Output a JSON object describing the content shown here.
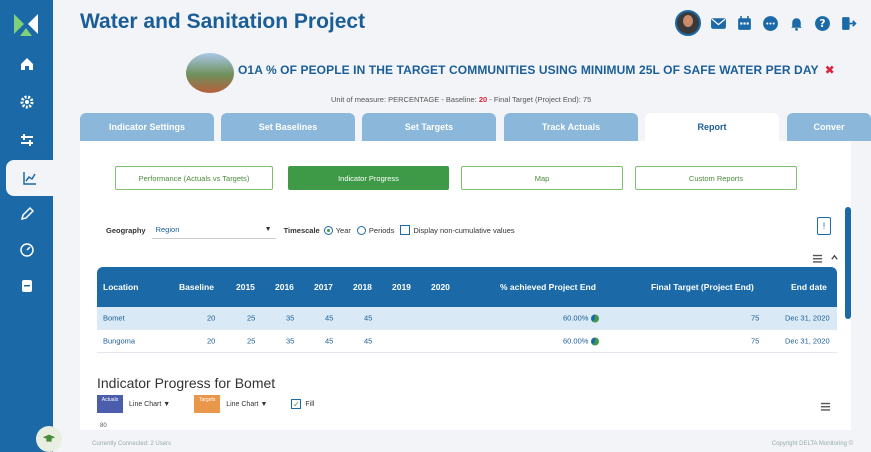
{
  "header": {
    "title": "Water and Sanitation Project"
  },
  "indicator": {
    "title": "O1A % OF PEOPLE IN THE TARGET COMMUNITIES USING MINIMUM 25L OF SAFE WATER PER DAY",
    "close_symbol": "✖",
    "unit_prefix": "Unit of measure: PERCENTAGE - Baseline: ",
    "baseline": "20",
    "final_target_text": " - Final Target (Project End): 75"
  },
  "tabs": [
    {
      "label": "Indicator Settings"
    },
    {
      "label": "Set Baselines"
    },
    {
      "label": "Set Targets"
    },
    {
      "label": "Track Actuals"
    },
    {
      "label": "Report"
    },
    {
      "label": "Conver"
    }
  ],
  "report_buttons": [
    {
      "label": "Performance (Actuals vs Targets)"
    },
    {
      "label": "Indicator Progress"
    },
    {
      "label": "Map"
    },
    {
      "label": "Custom Reports"
    }
  ],
  "filters": {
    "geography_label": "Geography",
    "geography_value": "Region",
    "timescale_label": "Timescale",
    "year_label": "Year",
    "periods_label": "Periods",
    "noncumulative_label": "Display non-cumulative values"
  },
  "info_button": "!",
  "table": {
    "columns": [
      "Location",
      "Baseline",
      "2015",
      "2016",
      "2017",
      "2018",
      "2019",
      "2020",
      "% achieved Project End",
      "Final Target (Project End)",
      "End date"
    ],
    "rows": [
      {
        "location": "Bomet",
        "baseline": "20",
        "y2015": "25",
        "y2016": "35",
        "y2017": "45",
        "y2018": "45",
        "y2019": "",
        "y2020": "",
        "achieved": "60.00%",
        "achieved_fraction": 0.6,
        "final_target": "75",
        "end_date": "Dec 31, 2020"
      },
      {
        "location": "Bungoma",
        "baseline": "20",
        "y2015": "25",
        "y2016": "35",
        "y2017": "45",
        "y2018": "45",
        "y2019": "",
        "y2020": "",
        "achieved": "60.00%",
        "achieved_fraction": 0.6,
        "final_target": "75",
        "end_date": "Dec 31, 2020"
      }
    ]
  },
  "chart_section": {
    "title": "Indicator Progress for Bomet",
    "actuals_label": "Actuals",
    "actuals_chart": "Line Chart",
    "targets_label": "Targets",
    "targets_chart": "Line Chart",
    "fill_label": "Fill",
    "y_first_tick": "80"
  },
  "footer": {
    "left": "Currently Connected: 2 Users",
    "right": "Copyright DELTA Monitoring ©"
  },
  "colors": {
    "primary": "#1b6aa7",
    "accent_green": "#3f9a48",
    "close_red": "#d7263d",
    "actuals": "#4b5dad",
    "targets": "#e9974a"
  }
}
